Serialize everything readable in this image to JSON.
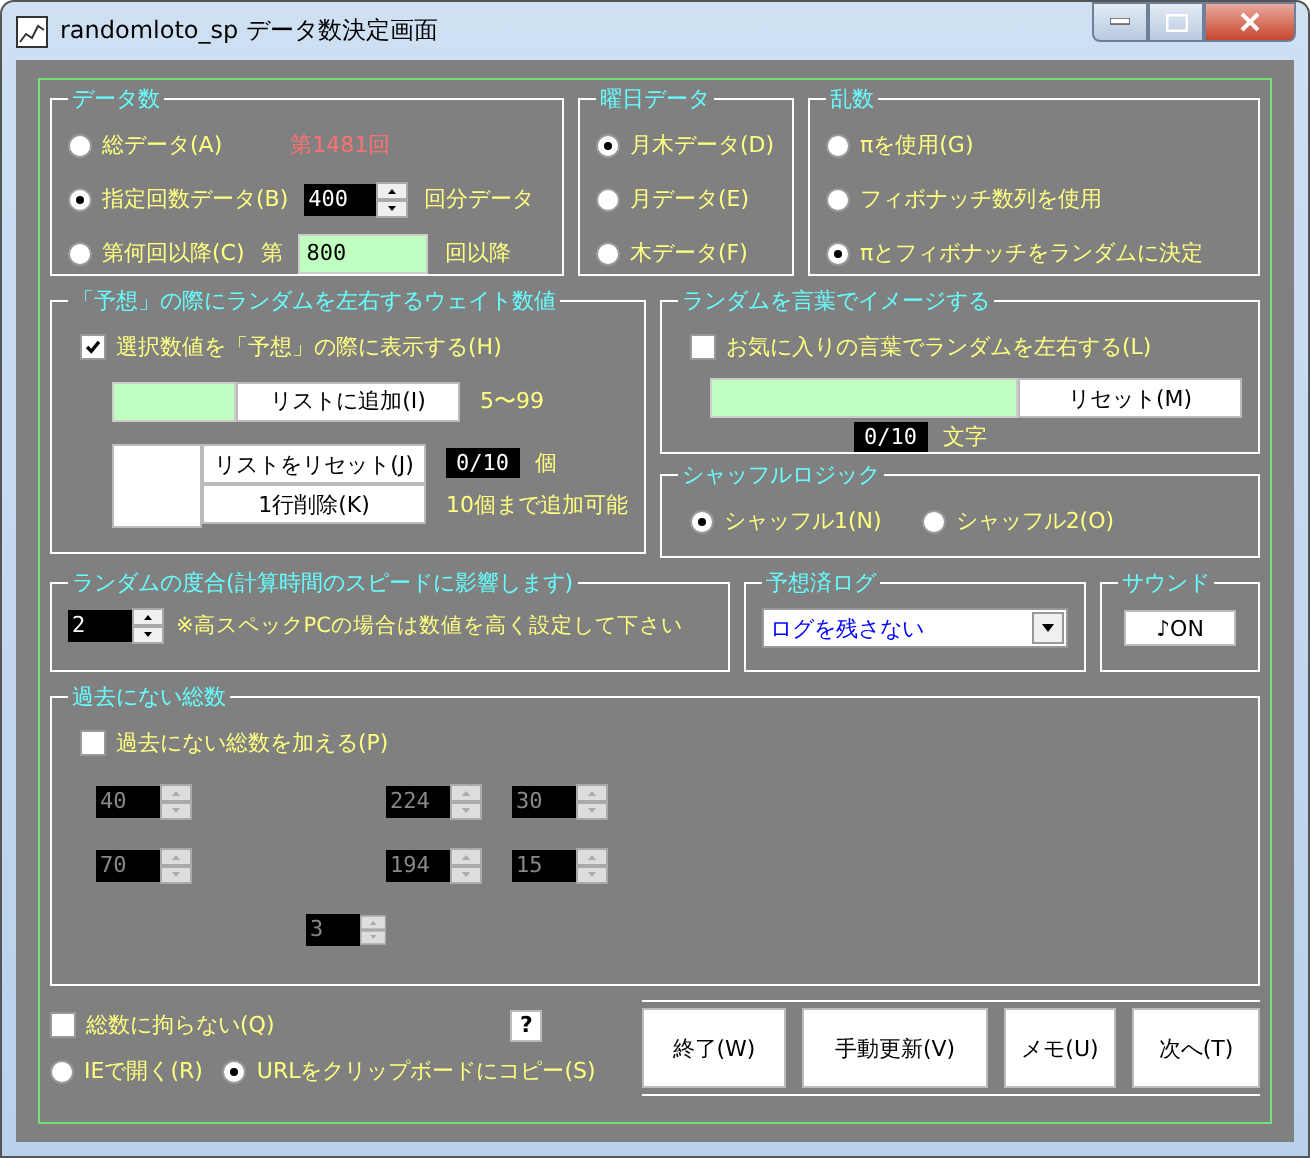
{
  "window": {
    "title": "randomloto_sp  データ数決定画面"
  },
  "data_count": {
    "title": "データ数",
    "options": [
      {
        "label": "総データ(A)",
        "selected": false
      },
      {
        "label": "指定回数データ(B)",
        "selected": true
      },
      {
        "label": "第何回以降(C)",
        "selected": false
      }
    ],
    "latest": "第1481回",
    "count_value": "400",
    "count_suffix": "回分データ",
    "from_prefix": "第",
    "from_value": "800",
    "from_suffix": "回以降"
  },
  "weekday": {
    "title": "曜日データ",
    "options": [
      {
        "label": "月木データ(D)",
        "selected": true
      },
      {
        "label": "月データ(E)",
        "selected": false
      },
      {
        "label": "木データ(F)",
        "selected": false
      }
    ]
  },
  "random": {
    "title": "乱数",
    "options": [
      {
        "label": "πを使用(G)",
        "selected": false
      },
      {
        "label": "フィボナッチ数列を使用",
        "selected": false
      },
      {
        "label": "πとフィボナッチをランダムに決定",
        "selected": true
      }
    ]
  },
  "weight": {
    "title": "「予想」の際にランダムを左右するウェイト数値",
    "checkbox": {
      "label": "選択数値を「予想」の際に表示する(H)",
      "checked": true
    },
    "add_button": "リストに追加(I)",
    "range": "5〜99",
    "reset_button": "リストをリセット(J)",
    "counter": "0/10",
    "counter_unit": "個",
    "delete_button": "1行削除(K)",
    "limit_note": "10個まで追加可能"
  },
  "words": {
    "title": "ランダムを言葉でイメージする",
    "checkbox": {
      "label": "お気に入りの言葉でランダムを左右する(L)",
      "checked": false
    },
    "reset_button": "リセット(M)",
    "counter": "0/10",
    "counter_unit": "文字"
  },
  "shuffle": {
    "title": "シャッフルロジック",
    "options": [
      {
        "label": "シャッフル1(N)",
        "selected": true
      },
      {
        "label": "シャッフル2(O)",
        "selected": false
      }
    ]
  },
  "randomness": {
    "title": "ランダムの度合(計算時間のスピードに影響します)",
    "value": "2",
    "note": "※高スペックPCの場合は数値を高く設定して下さい"
  },
  "log": {
    "title": "予想済ログ",
    "value": "ログを残さない"
  },
  "sound": {
    "title": "サウンド",
    "button": "♪ON"
  },
  "unseen_totals": {
    "title": "過去にない総数",
    "checkbox": {
      "label": "過去にない総数を加える(P)",
      "checked": false
    },
    "spinners": [
      {
        "value": "40",
        "disabled": true
      },
      {
        "value": "224",
        "disabled": true
      },
      {
        "value": "30",
        "disabled": true
      },
      {
        "value": "70",
        "disabled": true
      },
      {
        "value": "194",
        "disabled": true
      },
      {
        "value": "15",
        "disabled": true
      },
      {
        "value": "3",
        "disabled": true
      }
    ]
  },
  "footer": {
    "checkbox": {
      "label": "総数に拘らない(Q)",
      "checked": false
    },
    "open_options": [
      {
        "label": "IEで開く(R)",
        "selected": false
      },
      {
        "label": "URLをクリップボードにコピー(S)",
        "selected": true
      }
    ],
    "help": "?",
    "buttons": [
      "終了(W)",
      "手動更新(V)",
      "メモ(U)",
      "次へ(T)"
    ]
  }
}
